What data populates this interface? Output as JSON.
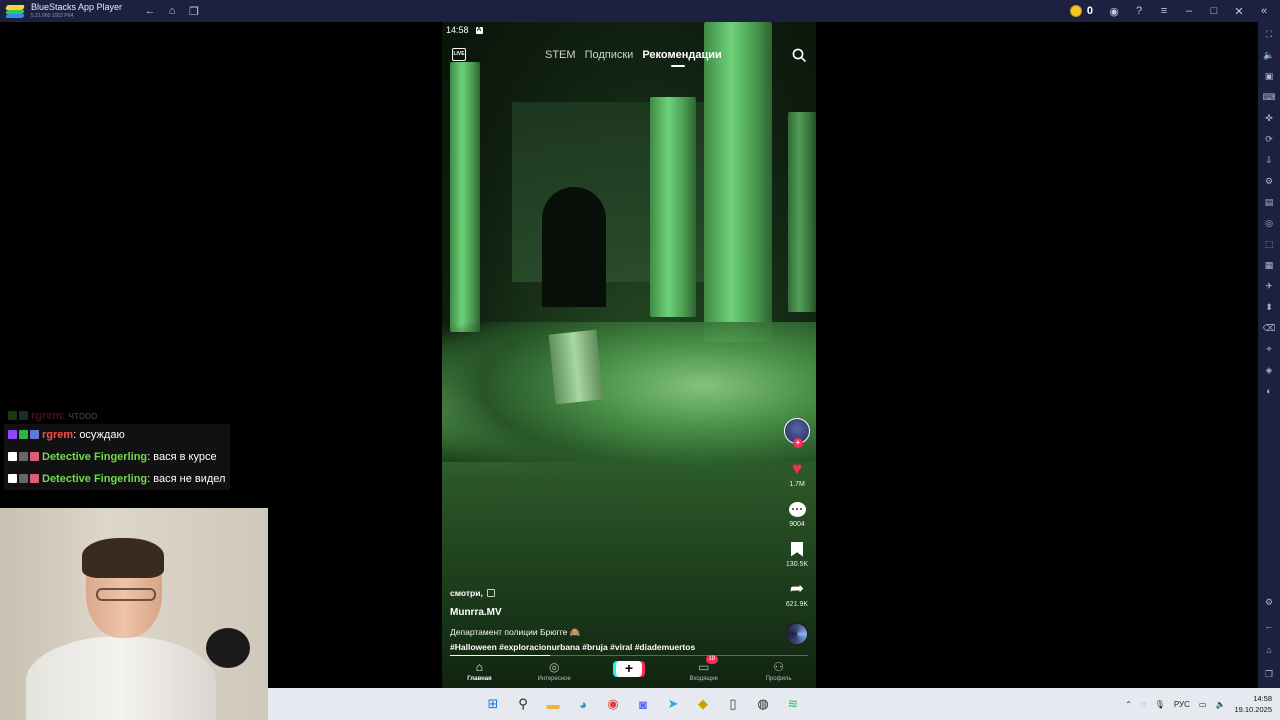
{
  "window": {
    "app_name": "BlueStacks App Player",
    "version": "5.21.660.1002 P64",
    "coin_count": "0"
  },
  "phone": {
    "status_time": "14:58",
    "live_label": "LIVE",
    "tabs": [
      "STEM",
      "Подписки",
      "Рекомендации"
    ],
    "active_tab": "Рекомендации",
    "actions": {
      "likes": "1.7M",
      "comments": "9004",
      "saves": "130.5K",
      "shares": "621.9K"
    },
    "caption": {
      "watch_tag": "смотри,",
      "author": "Munrra.MV",
      "description": "Департамент полиции Брюгге 🙈",
      "hashtags": "#Halloween #exploracionurbana #bruja #viral #diademuertos"
    },
    "progress_fraction": 0.28,
    "bottom_nav": {
      "home": "Главная",
      "discover": "Интересное",
      "inbox": "Входящие",
      "inbox_badge": "18",
      "profile": "Профиль"
    }
  },
  "chat": [
    {
      "user": "rgrem",
      "message": "чтооо",
      "color": "red",
      "faded": true
    },
    {
      "user": "rgrem",
      "message": "осуждаю",
      "color": "red",
      "faded": false
    },
    {
      "user": "Detective Fingerling",
      "message": "вася в курсе",
      "color": "green",
      "faded": false
    },
    {
      "user": "Detective Fingerling",
      "message": "вася не видел",
      "color": "green",
      "faded": false
    }
  ],
  "taskbar": {
    "language": "РУС",
    "time": "14:58",
    "date": "19.10.2025"
  },
  "colors": {
    "tiktok_red": "#fe2c55",
    "tiktok_cyan": "#25f4ee",
    "bluestacks_chrome": "#1c2140",
    "chat_green": "#6fdc4c",
    "chat_red": "#ff4d4d"
  }
}
